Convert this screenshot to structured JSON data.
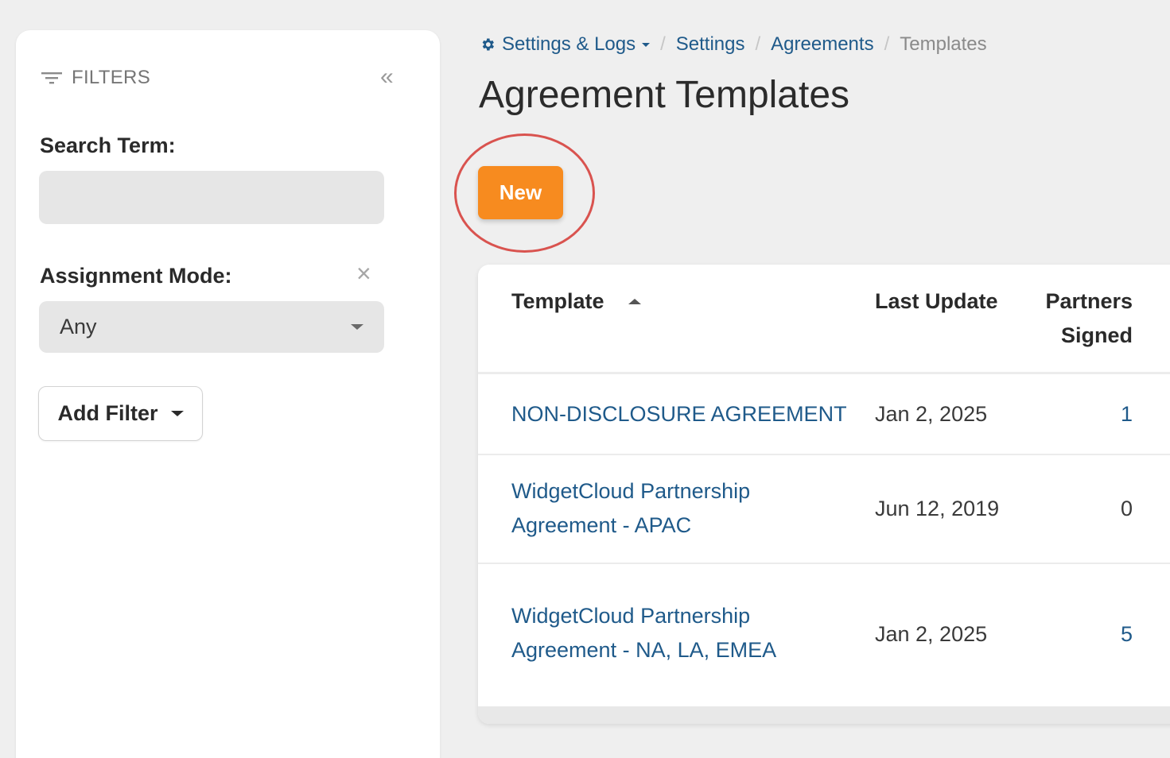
{
  "sidebar": {
    "filters_label": "FILTERS",
    "search": {
      "label": "Search Term:",
      "value": "",
      "placeholder": ""
    },
    "assignment_mode": {
      "label": "Assignment Mode:",
      "selected": "Any",
      "clear_glyph": "×"
    },
    "add_filter_label": "Add Filter",
    "collapse_glyph": "«"
  },
  "breadcrumb": {
    "items": [
      "Settings & Logs",
      "Settings",
      "Agreements",
      "Templates"
    ],
    "separator": "/"
  },
  "page_title": "Agreement Templates",
  "new_button_label": "New",
  "table": {
    "columns": {
      "template": "Template",
      "last_update": "Last Update",
      "partners_line1": "Partners",
      "partners_line2": "Signed"
    },
    "sort": {
      "column": "template",
      "direction": "asc"
    },
    "rows": [
      {
        "name_line1": "NON-DISCLOSURE AGREEMENT",
        "name_line2": "",
        "last_update": "Jan 2, 2025",
        "partners_signed": "1"
      },
      {
        "name_line1": "WidgetCloud Partnership",
        "name_line2": "Agreement - APAC",
        "last_update": "Jun 12, 2019",
        "partners_signed": "0"
      },
      {
        "name_line1": "WidgetCloud Partnership",
        "name_line2": "Agreement - NA, LA, EMEA",
        "last_update": "Jan 2, 2025",
        "partners_signed": "5"
      }
    ]
  },
  "colors": {
    "accent_orange": "#f78b1f",
    "link_blue": "#1f5a8a",
    "highlight_red": "#d9534f"
  },
  "icons": {
    "filters": "filter-lines-icon",
    "collapse": "double-chevron-left-icon",
    "gear": "gear-icon",
    "clear": "close-icon",
    "select_caret": "caret-down-icon",
    "sort": "sort-ascending-icon"
  }
}
